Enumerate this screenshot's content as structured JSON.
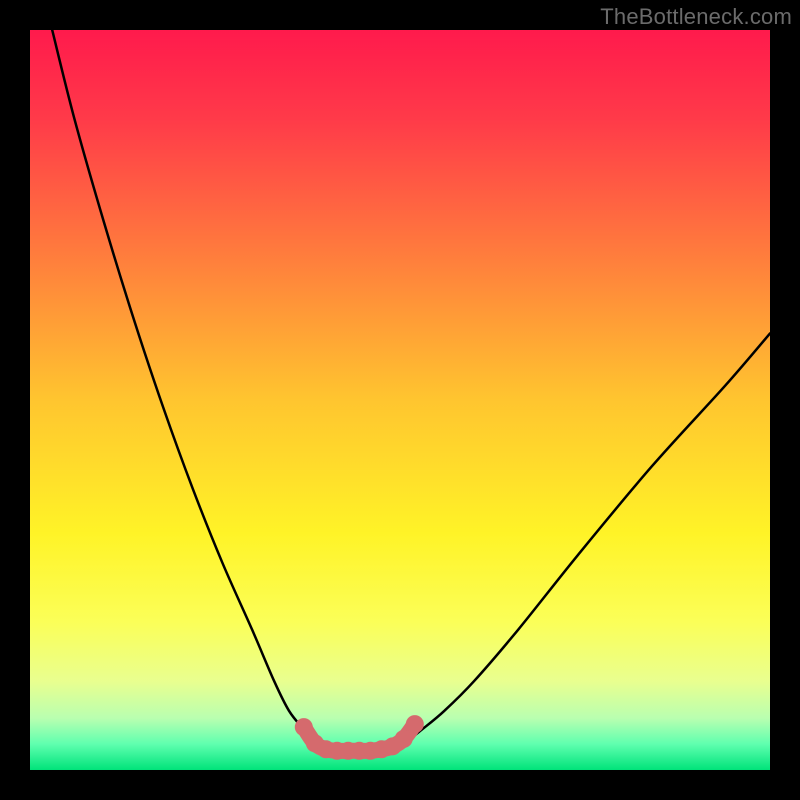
{
  "watermark": "TheBottleneck.com",
  "chart_data": {
    "type": "line",
    "title": "",
    "xlabel": "",
    "ylabel": "",
    "xlim": [
      0,
      100
    ],
    "ylim": [
      0,
      100
    ],
    "grid": false,
    "legend": false,
    "background_gradient_stops": [
      {
        "pos": 0.0,
        "color": "#ff1a4c"
      },
      {
        "pos": 0.12,
        "color": "#ff3a49"
      },
      {
        "pos": 0.3,
        "color": "#ff7b3d"
      },
      {
        "pos": 0.5,
        "color": "#ffc52f"
      },
      {
        "pos": 0.68,
        "color": "#fff327"
      },
      {
        "pos": 0.8,
        "color": "#fbff58"
      },
      {
        "pos": 0.88,
        "color": "#e9ff8f"
      },
      {
        "pos": 0.93,
        "color": "#b9ffb0"
      },
      {
        "pos": 0.965,
        "color": "#5fffaf"
      },
      {
        "pos": 1.0,
        "color": "#00e37a"
      }
    ],
    "series": [
      {
        "name": "left-curve",
        "color": "#000000",
        "x": [
          3,
          6,
          10,
          14,
          18,
          22,
          26,
          30,
          33,
          35,
          37,
          38.5,
          40
        ],
        "y": [
          100,
          88,
          74,
          61,
          49,
          38,
          28,
          19,
          12,
          8,
          5.5,
          4,
          3.2
        ]
      },
      {
        "name": "right-curve",
        "color": "#000000",
        "x": [
          49,
          51,
          53,
          56,
          60,
          66,
          74,
          84,
          94,
          100
        ],
        "y": [
          3.2,
          4,
          5.5,
          8,
          12,
          19,
          29,
          41,
          52,
          59
        ]
      },
      {
        "name": "bottom-marker-band",
        "color": "#d56a6d",
        "x": [
          37,
          38.5,
          40,
          41.5,
          43,
          44.5,
          46,
          47.5,
          49,
          50.5,
          52
        ],
        "y": [
          5.8,
          3.6,
          2.8,
          2.6,
          2.6,
          2.6,
          2.6,
          2.8,
          3.2,
          4.2,
          6.2
        ]
      }
    ]
  }
}
